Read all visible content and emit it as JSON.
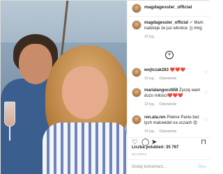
{
  "post": {
    "username": "magdagessler_official"
  },
  "comments": [
    {
      "user": "magdagessler_official",
      "verified": true,
      "text": "Mam nadzieje ze juz wkrotce :)) #mg",
      "time": "19 tyg."
    },
    {
      "user": "wojtczak283",
      "text": "❤️❤️❤️",
      "time": "19 tyg.",
      "reply": "Odpowiedz"
    },
    {
      "user": "marialangocz658",
      "text": "Życzę wam dużo miłości❤️❤️❤️",
      "time": "19 tyg.",
      "reply": "Odpowiedz"
    },
    {
      "user": "ren.ata.ren",
      "text": "Piekne Panie bez tych malowidel na oczach 😍",
      "time": "19 tyg.",
      "reply": "Odpowiedz"
    }
  ],
  "likes": {
    "label": "Liczba polubień:",
    "count": "35 767"
  },
  "date": "12 LIPCA",
  "add_comment": {
    "placeholder": "Dodaj komentarz...",
    "post_label": "Opu"
  },
  "icons": {
    "like": "heart-icon",
    "comment": "comment-icon",
    "share": "share-icon",
    "save": "bookmark-icon",
    "load_more": "plus-circle-icon"
  }
}
